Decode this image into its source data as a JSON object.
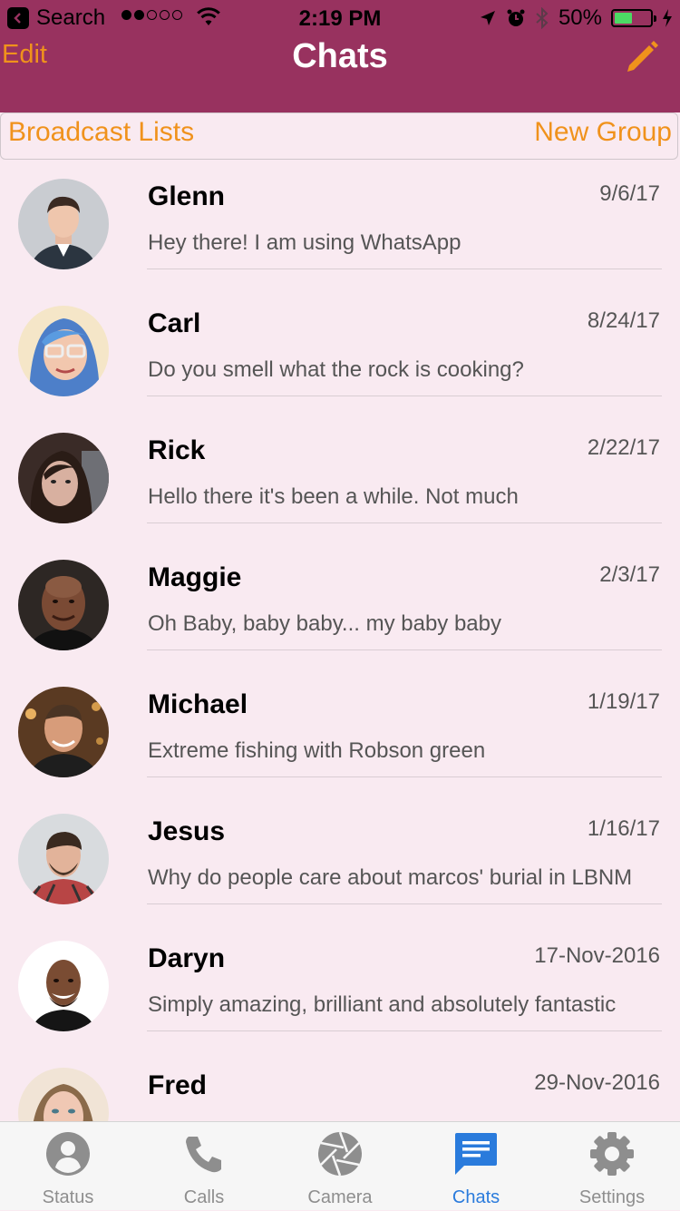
{
  "status_bar": {
    "back_label": "Search",
    "time": "2:19 PM",
    "battery": "50%",
    "battery_level": 0.5
  },
  "nav": {
    "edit_label": "Edit",
    "title": "Chats",
    "compose_icon": "pencil-icon"
  },
  "subbar": {
    "broadcast_label": "Broadcast Lists",
    "new_group_label": "New Group"
  },
  "chats": [
    {
      "name": "Glenn",
      "date": "9/6/17",
      "message": "Hey there! I am using WhatsApp"
    },
    {
      "name": "Carl",
      "date": "8/24/17",
      "message": "Do you smell what the rock is cooking?"
    },
    {
      "name": "Rick",
      "date": "2/22/17",
      "message": "Hello there it's been a while. Not much"
    },
    {
      "name": "Maggie",
      "date": "2/3/17",
      "message": "Oh Baby, baby baby... my baby baby"
    },
    {
      "name": "Michael",
      "date": "1/19/17",
      "message": "Extreme fishing with Robson green"
    },
    {
      "name": "Jesus",
      "date": "1/16/17",
      "message": "Why do people care about marcos' burial in LBNM"
    },
    {
      "name": "Daryn",
      "date": "17-Nov-2016",
      "message": "Simply amazing, brilliant and absolutely fantastic"
    },
    {
      "name": "Fred",
      "date": "29-Nov-2016",
      "message": ""
    }
  ],
  "tabs": [
    {
      "label": "Status",
      "icon": "person-icon",
      "active": false
    },
    {
      "label": "Calls",
      "icon": "phone-icon",
      "active": false
    },
    {
      "label": "Camera",
      "icon": "camera-aperture-icon",
      "active": false
    },
    {
      "label": "Chats",
      "icon": "chat-bubble-icon",
      "active": true
    },
    {
      "label": "Settings",
      "icon": "gear-icon",
      "active": false
    }
  ],
  "colors": {
    "header": "#98325f",
    "accent": "#f0921c",
    "background": "#f9eaf1",
    "tab_active": "#2a7bdc",
    "tab_inactive": "#8e8e8e"
  }
}
